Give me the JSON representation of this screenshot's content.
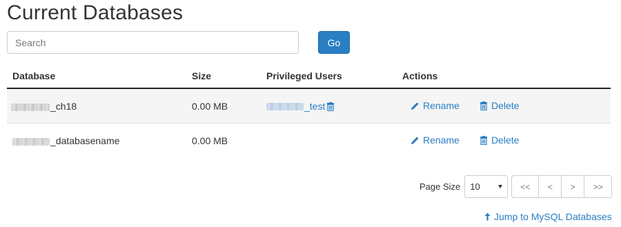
{
  "page": {
    "title": "Current Databases"
  },
  "search": {
    "placeholder": "Search",
    "value": "",
    "go_label": "Go"
  },
  "table": {
    "headers": {
      "database": "Database",
      "size": "Size",
      "privileged_users": "Privileged Users",
      "actions": "Actions"
    },
    "rows": [
      {
        "database_suffix": "_ch18",
        "size": "0.00 MB",
        "user_suffix": "_test",
        "rename_label": "Rename",
        "delete_label": "Delete"
      },
      {
        "database_suffix": "_databasename",
        "size": "0.00 MB",
        "user_suffix": "",
        "rename_label": "Rename",
        "delete_label": "Delete"
      }
    ]
  },
  "pagination": {
    "page_size_label": "Page Size",
    "page_size_value": "10",
    "first_label": "<<",
    "prev_label": "<",
    "next_label": ">",
    "last_label": ">>"
  },
  "footer": {
    "jump_label": "Jump to MySQL Databases"
  },
  "colors": {
    "accent": "#2a7ec4",
    "text": "#333333",
    "row_alt": "#f5f5f5"
  },
  "icons": {
    "rename": "pencil-icon",
    "delete": "trash-icon",
    "remove_user": "trash-icon",
    "jump": "arrow-up-icon"
  }
}
